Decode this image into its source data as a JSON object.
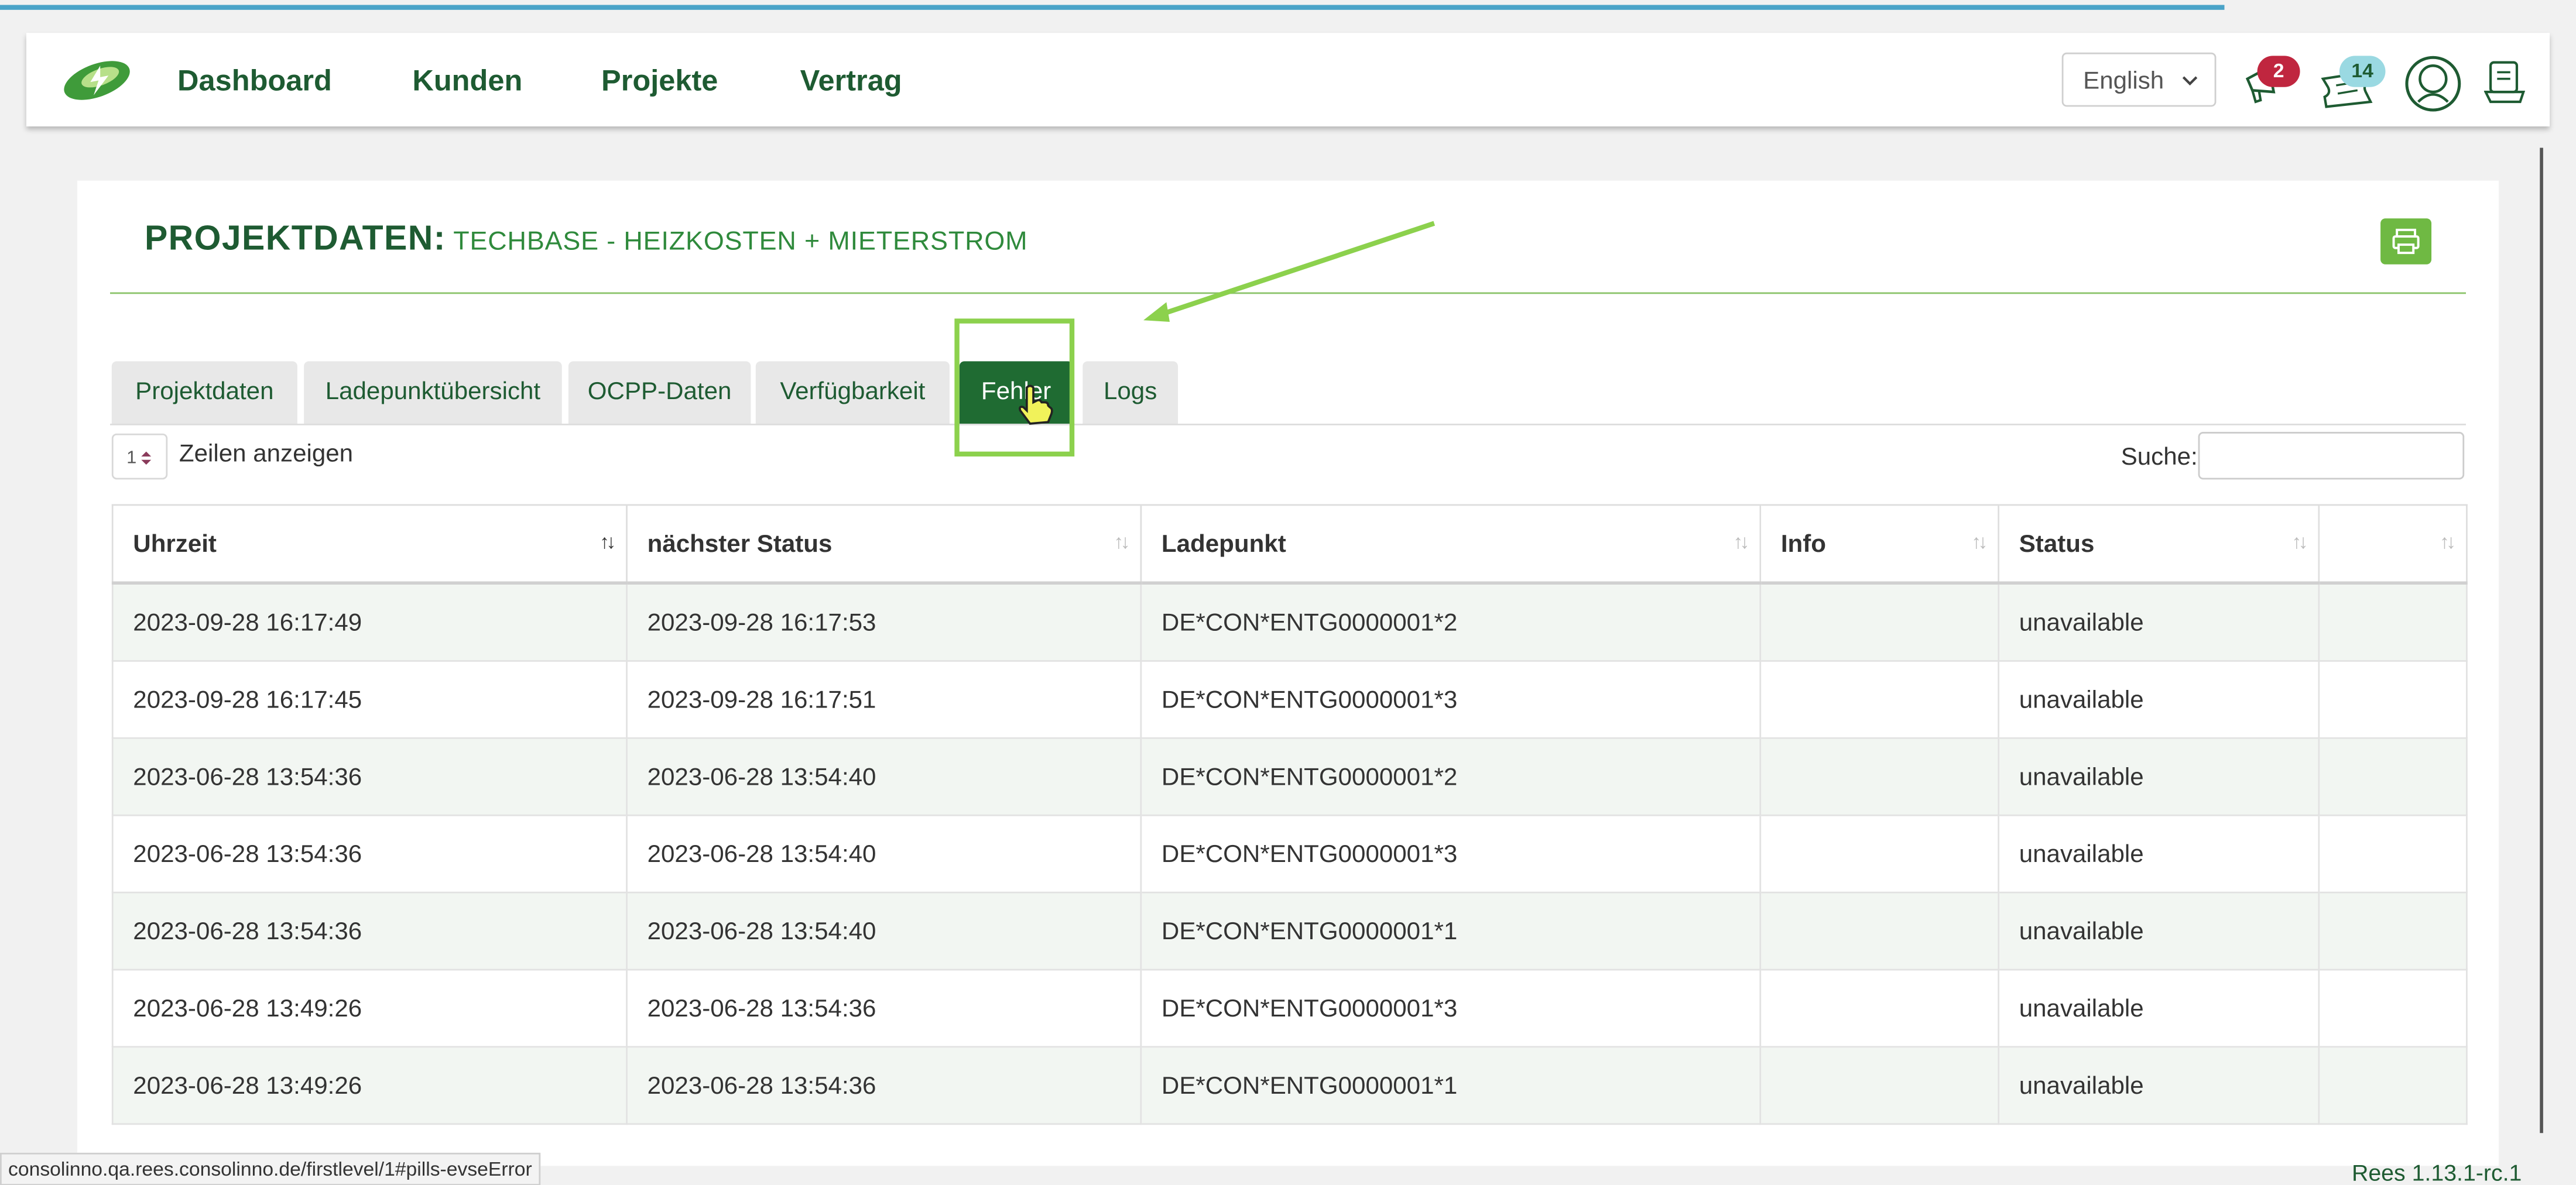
{
  "nav": {
    "items": [
      {
        "label": "Dashboard"
      },
      {
        "label": "Kunden"
      },
      {
        "label": "Projekte"
      },
      {
        "label": "Vertrag"
      }
    ],
    "language": "English",
    "notifications_count": "2",
    "tickets_count": "14"
  },
  "page": {
    "title": "PROJEKTDATEN:",
    "subtitle": "TECHBASE - HEIZKOSTEN + MIETERSTROM"
  },
  "tabs": [
    {
      "label": "Projektdaten"
    },
    {
      "label": "Ladepunktübersicht"
    },
    {
      "label": "OCPP-Daten"
    },
    {
      "label": "Verfügbarkeit"
    },
    {
      "label": "Fehler",
      "active": true
    },
    {
      "label": "Logs"
    }
  ],
  "table_controls": {
    "length_value": "1",
    "length_label": "Zeilen anzeigen",
    "search_label": "Suche:",
    "search_value": ""
  },
  "table": {
    "columns": [
      "Uhrzeit",
      "nächster Status",
      "Ladepunkt",
      "Info",
      "Status",
      ""
    ],
    "rows": [
      {
        "time": "2023-09-28 16:17:49",
        "next": "2023-09-28 16:17:53",
        "point": "DE*CON*ENTG0000001*2",
        "info": "",
        "status": "unavailable",
        "extra": ""
      },
      {
        "time": "2023-09-28 16:17:45",
        "next": "2023-09-28 16:17:51",
        "point": "DE*CON*ENTG0000001*3",
        "info": "",
        "status": "unavailable",
        "extra": ""
      },
      {
        "time": "2023-06-28 13:54:36",
        "next": "2023-06-28 13:54:40",
        "point": "DE*CON*ENTG0000001*2",
        "info": "",
        "status": "unavailable",
        "extra": ""
      },
      {
        "time": "2023-06-28 13:54:36",
        "next": "2023-06-28 13:54:40",
        "point": "DE*CON*ENTG0000001*3",
        "info": "",
        "status": "unavailable",
        "extra": ""
      },
      {
        "time": "2023-06-28 13:54:36",
        "next": "2023-06-28 13:54:40",
        "point": "DE*CON*ENTG0000001*1",
        "info": "",
        "status": "unavailable",
        "extra": ""
      },
      {
        "time": "2023-06-28 13:49:26",
        "next": "2023-06-28 13:54:36",
        "point": "DE*CON*ENTG0000001*3",
        "info": "",
        "status": "unavailable",
        "extra": ""
      },
      {
        "time": "2023-06-28 13:49:26",
        "next": "2023-06-28 13:54:36",
        "point": "DE*CON*ENTG0000001*1",
        "info": "",
        "status": "unavailable",
        "extra": ""
      }
    ]
  },
  "statusbar": {
    "url": "consolinno.qa.rees.consolinno.de/firstlevel/1#pills-evseError",
    "version": "Rees 1.13.1-rc.1"
  },
  "colors": {
    "brand_dark": "#1e5b32",
    "brand_light": "#6fb943",
    "highlight": "#8cd14d",
    "badge_red": "#c0263f",
    "badge_cyan": "#9ad9e2"
  },
  "icons": [
    "logo-icon",
    "megaphone-icon",
    "ticket-icon",
    "user-icon",
    "cart-icon",
    "printer-icon",
    "chevron-down-icon",
    "sort-icon",
    "hand-cursor-icon"
  ]
}
